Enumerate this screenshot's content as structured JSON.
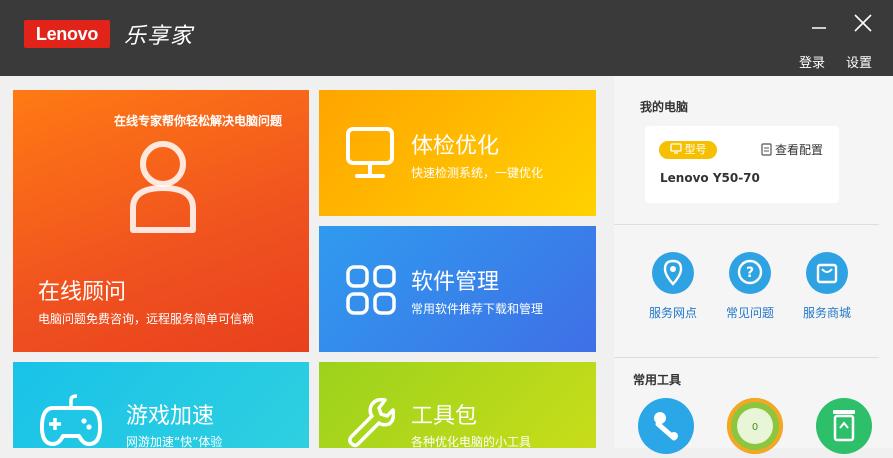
{
  "app": {
    "brand": "Lenovo",
    "product": "乐享家"
  },
  "titlebar": {
    "login": "登录",
    "settings": "设置"
  },
  "tiles": {
    "advisor": {
      "tagline": "在线专家帮你轻松解决电脑问题",
      "title": "在线顾问",
      "subtitle": "电脑问题免费咨询，远程服务简单可信赖"
    },
    "checkup": {
      "title": "体检优化",
      "subtitle": "快速检测系统，一键优化"
    },
    "software": {
      "title": "软件管理",
      "subtitle": "常用软件推荐下载和管理"
    },
    "game": {
      "title": "游戏加速",
      "subtitle": "网游加速“快”体验"
    },
    "toolkit": {
      "title": "工具包",
      "subtitle": "各种优化电脑的小工具"
    }
  },
  "my_pc": {
    "label": "我的电脑",
    "model_badge": "型号",
    "view_config": "查看配置",
    "model": "Lenovo Y50-70"
  },
  "services": [
    {
      "label": "服务网点",
      "icon": "location-pin-icon"
    },
    {
      "label": "常见问题",
      "icon": "question-icon"
    },
    {
      "label": "服务商城",
      "icon": "shopping-bag-icon"
    }
  ],
  "tools": {
    "label": "常用工具"
  },
  "colors": {
    "titlebar": "#3a3a3a",
    "brand_red": "#e2231a",
    "advisor_tile": "#f25a1d",
    "checkup_tile": "#ffc400",
    "software_tile": "#3a86ea",
    "game_tile": "#1fc7e6",
    "toolkit_tile": "#a3d21d",
    "service_blue": "#2ea2e3"
  }
}
